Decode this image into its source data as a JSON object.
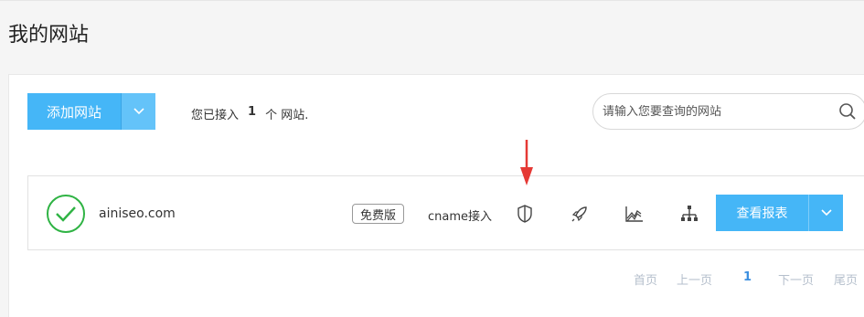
{
  "page": {
    "title": "我的网站"
  },
  "toolbar": {
    "add_label": "添加网站",
    "summary_prefix": "您已接入",
    "summary_count": "1",
    "summary_suffix": "个 网站."
  },
  "search": {
    "placeholder": "请输入您要查询的网站"
  },
  "site": {
    "domain": "ainiseo.com",
    "plan": "免费版",
    "access_type": "cname接入",
    "tools": [
      "shield-icon",
      "rocket-icon",
      "chart-icon",
      "sitemap-icon"
    ],
    "report_label": "查看报表"
  },
  "pagination": {
    "first": "首页",
    "prev": "上一页",
    "current": "1",
    "next": "下一页",
    "last": "尾页"
  },
  "colors": {
    "accent": "#45b6f7",
    "success": "#2fb344",
    "annotation": "#e53935"
  }
}
